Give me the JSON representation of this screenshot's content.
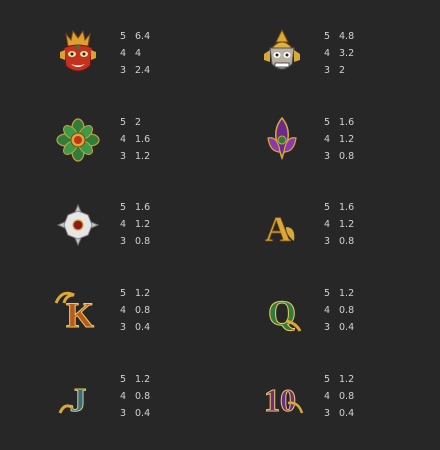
{
  "paytable": [
    {
      "symbol": "red-demon-mask",
      "pays": [
        {
          "count": "5",
          "value": "6.4"
        },
        {
          "count": "4",
          "value": "4"
        },
        {
          "count": "3",
          "value": "2.4"
        }
      ]
    },
    {
      "symbol": "golden-guardian-mask",
      "pays": [
        {
          "count": "5",
          "value": "4.8"
        },
        {
          "count": "4",
          "value": "3.2"
        },
        {
          "count": "3",
          "value": "2"
        }
      ]
    },
    {
      "symbol": "green-flower-ornament",
      "pays": [
        {
          "count": "5",
          "value": "2"
        },
        {
          "count": "4",
          "value": "1.6"
        },
        {
          "count": "3",
          "value": "1.2"
        }
      ]
    },
    {
      "symbol": "purple-lotus-ornament",
      "pays": [
        {
          "count": "5",
          "value": "1.6"
        },
        {
          "count": "4",
          "value": "1.2"
        },
        {
          "count": "3",
          "value": "0.8"
        }
      ]
    },
    {
      "symbol": "silver-diamond-ornament",
      "pays": [
        {
          "count": "5",
          "value": "1.6"
        },
        {
          "count": "4",
          "value": "1.2"
        },
        {
          "count": "3",
          "value": "0.8"
        }
      ]
    },
    {
      "symbol": "letter-a",
      "letter": "A",
      "pays": [
        {
          "count": "5",
          "value": "1.6"
        },
        {
          "count": "4",
          "value": "1.2"
        },
        {
          "count": "3",
          "value": "0.8"
        }
      ]
    },
    {
      "symbol": "letter-k",
      "letter": "K",
      "pays": [
        {
          "count": "5",
          "value": "1.2"
        },
        {
          "count": "4",
          "value": "0.8"
        },
        {
          "count": "3",
          "value": "0.4"
        }
      ]
    },
    {
      "symbol": "letter-q",
      "letter": "Q",
      "pays": [
        {
          "count": "5",
          "value": "1.2"
        },
        {
          "count": "4",
          "value": "0.8"
        },
        {
          "count": "3",
          "value": "0.4"
        }
      ]
    },
    {
      "symbol": "letter-j",
      "letter": "J",
      "pays": [
        {
          "count": "5",
          "value": "1.2"
        },
        {
          "count": "4",
          "value": "0.8"
        },
        {
          "count": "3",
          "value": "0.4"
        }
      ]
    },
    {
      "symbol": "number-10",
      "letter": "10",
      "pays": [
        {
          "count": "5",
          "value": "1.2"
        },
        {
          "count": "4",
          "value": "0.8"
        },
        {
          "count": "3",
          "value": "0.4"
        }
      ]
    }
  ],
  "colors": {
    "background": "#272727",
    "text": "#d2d2d2",
    "gold": "#d8a838",
    "red": "#c4321f",
    "green": "#2e7d3a",
    "purple": "#6b2a8c"
  }
}
